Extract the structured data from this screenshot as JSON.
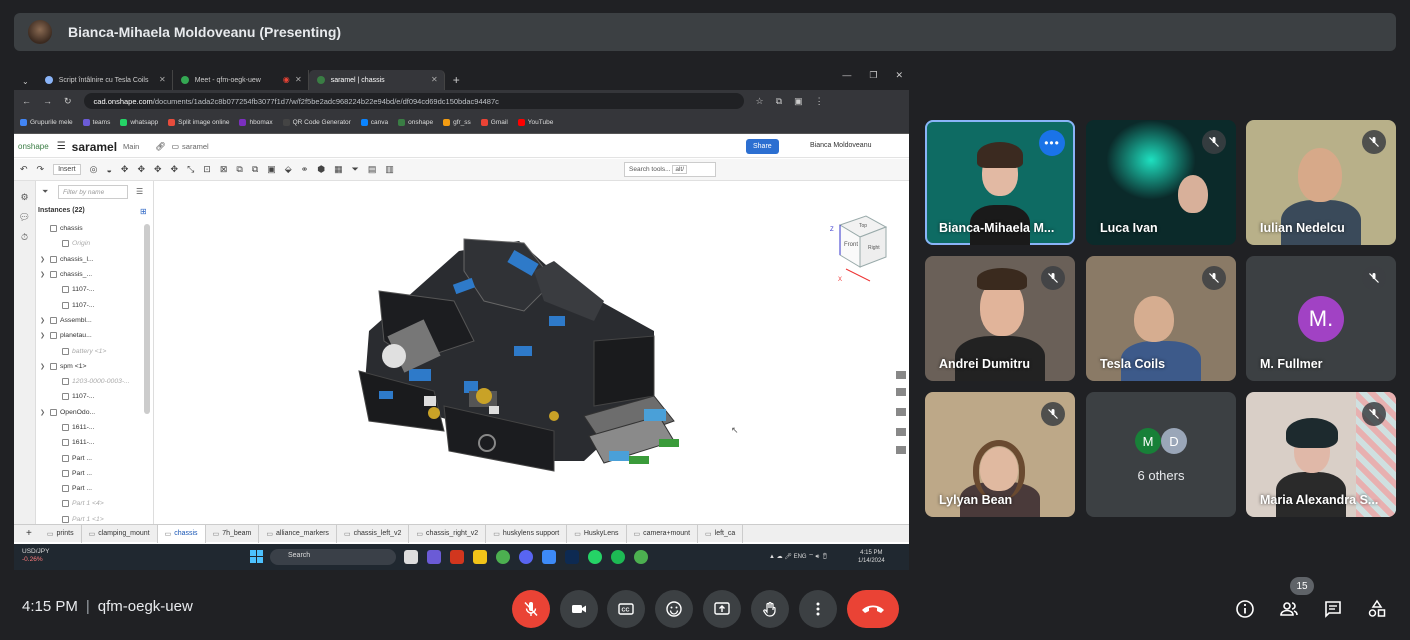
{
  "presenter": {
    "name": "Bianca-Mihaela Moldoveanu (Presenting)"
  },
  "browser": {
    "tabs": [
      {
        "label": "Script întâlnire cu Tesla Coils"
      },
      {
        "label": "Meet - qfm-oegk-uew"
      },
      {
        "label": "saramel | chassis"
      }
    ],
    "url_host": "cad.onshape.com",
    "url_path": "/documents/1ada2c8b077254fb3077f1d7/w/f2f5be2adc968224b22e94bd/e/df094cd69dc150bdac94487c",
    "bookmarks": [
      "Grupurile mele",
      "teams",
      "whatsapp",
      "Split image online",
      "hbomax",
      "QR Code Generator",
      "canva",
      "onshape",
      "gfr_ss",
      "Gmail",
      "YouTube"
    ]
  },
  "onshape": {
    "logo": "onshape",
    "doc_name": "saramel",
    "workspace": "Main",
    "folder": "saramel",
    "share_label": "Share",
    "user": "Bianca Moldoveanu",
    "insert_label": "Insert",
    "search_tools": "Search tools...",
    "search_hint": "alt/",
    "filter_placeholder": "Filter by name",
    "instances_header": "Instances (22)",
    "tree": [
      {
        "label": "chassis",
        "indent": 0,
        "caret": false,
        "dim": false
      },
      {
        "label": "Origin",
        "indent": 1,
        "caret": false,
        "dim": true
      },
      {
        "label": "chassis_l...",
        "indent": 0,
        "caret": true,
        "dim": false
      },
      {
        "label": "chassis_...",
        "indent": 0,
        "caret": true,
        "dim": false
      },
      {
        "label": "1107-...",
        "indent": 1,
        "caret": false,
        "dim": false
      },
      {
        "label": "1107-...",
        "indent": 1,
        "caret": false,
        "dim": false
      },
      {
        "label": "Assembl...",
        "indent": 0,
        "caret": true,
        "dim": false
      },
      {
        "label": "planetau...",
        "indent": 0,
        "caret": true,
        "dim": false
      },
      {
        "label": "battery <1>",
        "indent": 1,
        "caret": false,
        "dim": true
      },
      {
        "label": "spm <1>",
        "indent": 0,
        "caret": true,
        "dim": false
      },
      {
        "label": "1203-0000-0003-...",
        "indent": 1,
        "caret": false,
        "dim": true
      },
      {
        "label": "1107-...",
        "indent": 1,
        "caret": false,
        "dim": false
      },
      {
        "label": "OpenOdo...",
        "indent": 0,
        "caret": true,
        "dim": false
      },
      {
        "label": "1611-...",
        "indent": 1,
        "caret": false,
        "dim": false
      },
      {
        "label": "1611-...",
        "indent": 1,
        "caret": false,
        "dim": false
      },
      {
        "label": "Part ...",
        "indent": 1,
        "caret": false,
        "dim": false
      },
      {
        "label": "Part ...",
        "indent": 1,
        "caret": false,
        "dim": false
      },
      {
        "label": "Part ...",
        "indent": 1,
        "caret": false,
        "dim": false
      },
      {
        "label": "Part 1 <4>",
        "indent": 1,
        "caret": false,
        "dim": true
      },
      {
        "label": "Part 1 <1>",
        "indent": 1,
        "caret": false,
        "dim": true
      }
    ],
    "view_cube": {
      "front": "Front",
      "top": "Top",
      "right": "Right"
    },
    "tabs": [
      "prints",
      "clamping_mount",
      "chassis",
      "7h_beam",
      "alliance_markers",
      "chassis_left_v2",
      "chassis_right_v2",
      "huskylens support",
      "HuskyLens",
      "camera+mount",
      "left_ca"
    ],
    "active_tab": "chassis"
  },
  "taskbar": {
    "ticker_symbol": "USD/JPY",
    "ticker_change": "-0.26%",
    "search_placeholder": "Search",
    "lang": "ENG",
    "time": "4:15 PM",
    "date": "1/14/2024"
  },
  "participants": [
    {
      "name": "Bianca-Mihaela M...",
      "muted": false,
      "active": true
    },
    {
      "name": "Luca Ivan",
      "muted": true
    },
    {
      "name": "Iulian Nedelcu",
      "muted": true
    },
    {
      "name": "Andrei Dumitru",
      "muted": true
    },
    {
      "name": "Tesla Coils",
      "muted": true
    },
    {
      "name": "M. Fullmer",
      "initial": "M.",
      "muted": true
    },
    {
      "name": "Lylyan Bean",
      "muted": true
    },
    {
      "name": "6 others",
      "initials": [
        "M",
        "D"
      ]
    },
    {
      "name": "Maria Alexandra S...",
      "muted": true
    }
  ],
  "meeting": {
    "time": "4:15 PM",
    "code": "qfm-oegk-uew",
    "participant_count": "15"
  },
  "colors": {
    "hangup": "#ea4335",
    "background": "#202124",
    "tile": "#3c4043",
    "share": "#2c6fd1",
    "avatar_purple": "#a142c4"
  }
}
